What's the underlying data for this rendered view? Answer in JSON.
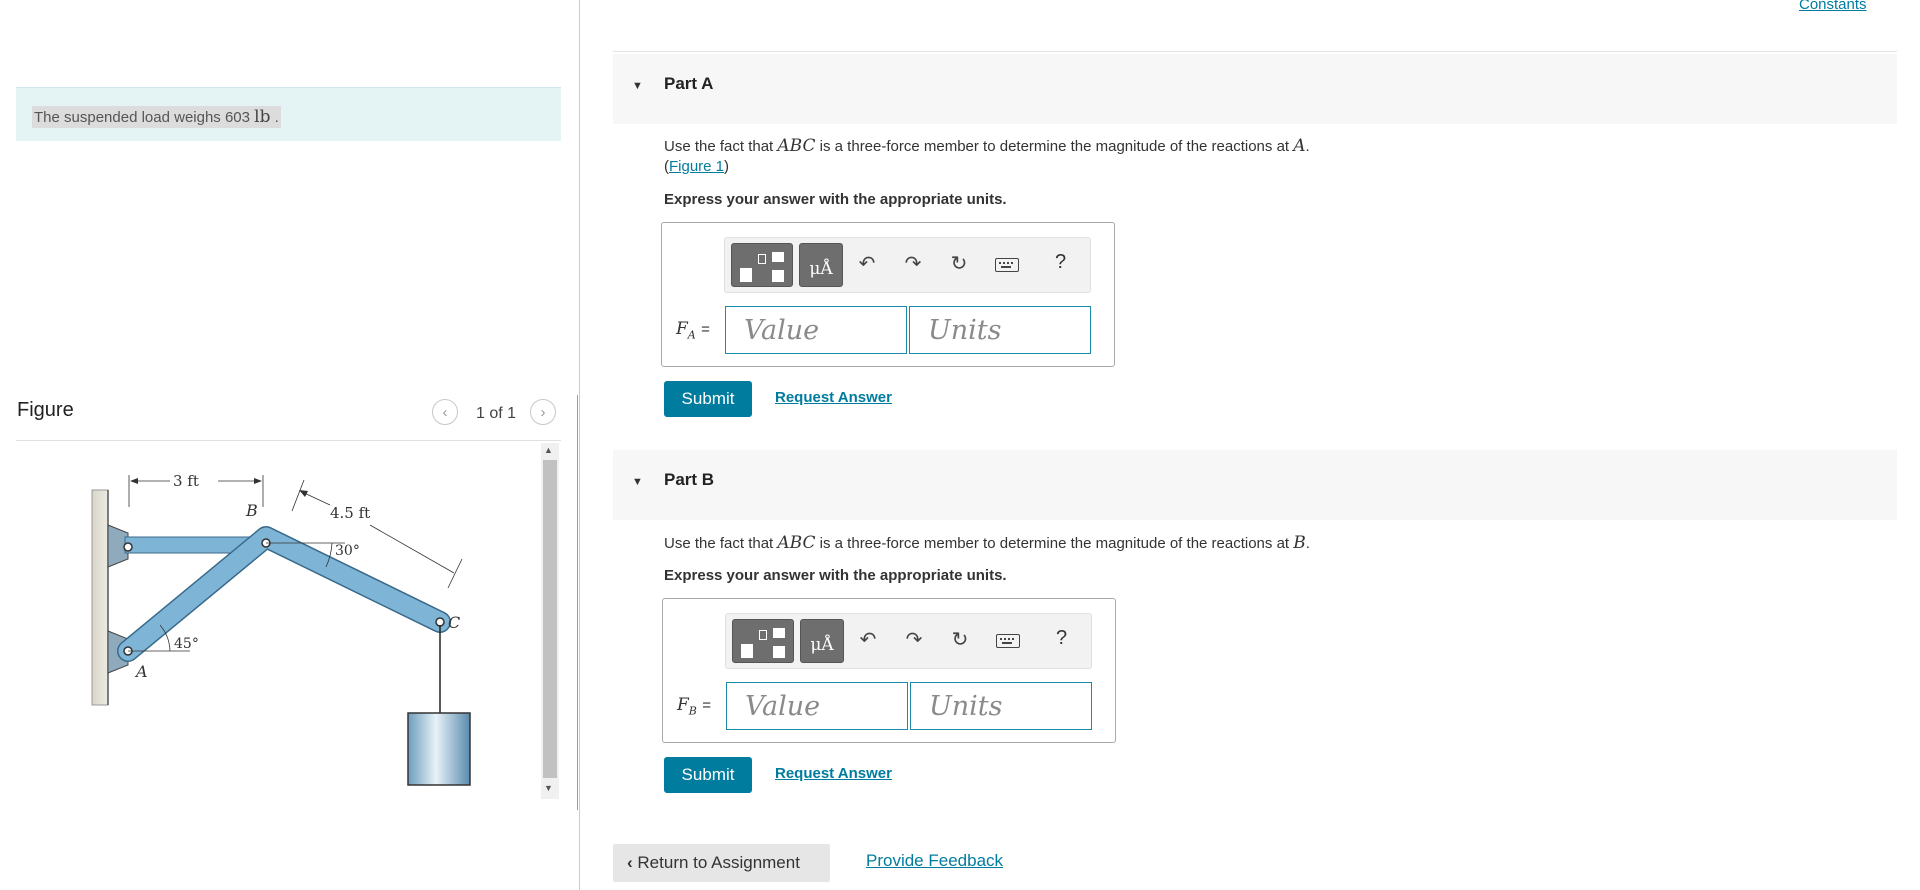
{
  "problem": {
    "text": "The suspended load weighs 603",
    "unit": "lb",
    "trail": " ."
  },
  "figure_panel": {
    "title": "Figure",
    "pager_text": "1 of 1",
    "prev_icon": "chevron-left-icon",
    "next_icon": "chevron-right-icon",
    "labels": {
      "dim_3ft": "3 ft",
      "dim_45ft": "4.5 ft",
      "angle_30": "30°",
      "angle_45": "45°",
      "point_a": "A",
      "point_b": "B",
      "point_c": "C"
    }
  },
  "header": {
    "constants_link": "Constants"
  },
  "part_a": {
    "title": "Part A",
    "q_pre": "Use the fact that",
    "q_abc": "ABC",
    "q_mid": "is a three-force member to determine the magnitude of the reactions at",
    "q_point": "A",
    "q_end": ".",
    "figure_link_open": "(",
    "figure_link": "Figure 1",
    "figure_link_close": ")",
    "express": "Express your answer with the appropriate units.",
    "var_symbol": "F",
    "var_sub": "A",
    "var_eq": "=",
    "value_placeholder": "Value",
    "units_placeholder": "Units",
    "submit": "Submit",
    "request": "Request Answer"
  },
  "part_b": {
    "title": "Part B",
    "q_pre": "Use the fact that",
    "q_abc": "ABC",
    "q_mid": "is a three-force member to determine the magnitude of the reactions at",
    "q_point": "B",
    "q_end": ".",
    "express": "Express your answer with the appropriate units.",
    "var_symbol": "F",
    "var_sub": "B",
    "var_eq": "=",
    "value_placeholder": "Value",
    "units_placeholder": "Units",
    "submit": "Submit",
    "request": "Request Answer"
  },
  "toolbar": {
    "mu_label": "μÅ",
    "undo_icon": "↶",
    "redo_icon": "↷",
    "reset_icon": "↻",
    "help": "?"
  },
  "footer": {
    "return": "Return to Assignment",
    "return_icon": "‹",
    "feedback": "Provide Feedback"
  },
  "colors": {
    "accent": "#007c9e",
    "problem_bg": "#e4f3f4",
    "member_blue": "#7eb4d6"
  }
}
